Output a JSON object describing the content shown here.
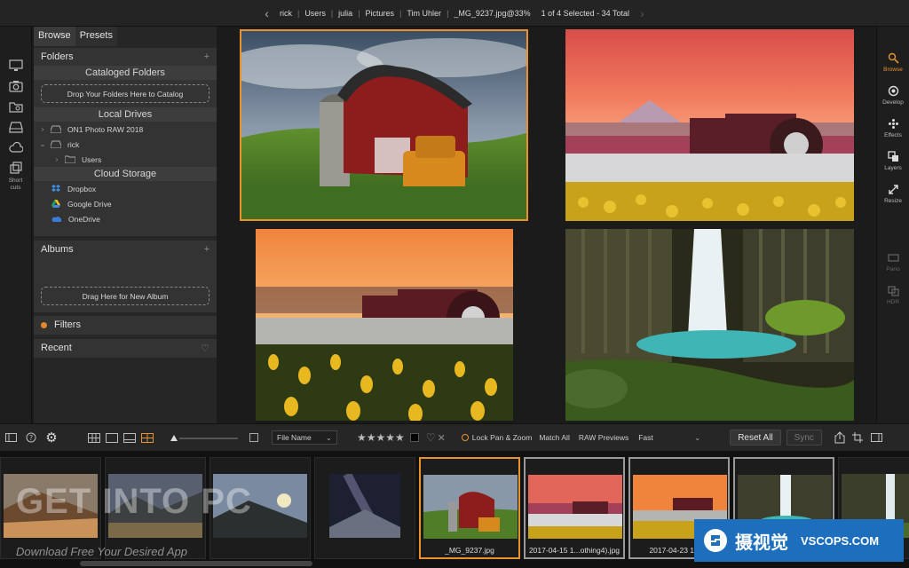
{
  "topbar": {
    "breadcrumbs": [
      "rick",
      "Users",
      "julia",
      "Pictures",
      "Tim Uhler",
      "_MG_9237.jpg@33%"
    ],
    "selection_status": "1 of 4 Selected - 34 Total"
  },
  "left_rail": {
    "shortcuts_label_1": "Short",
    "shortcuts_label_2": "cuts"
  },
  "panel": {
    "tabs": [
      "Browse",
      "Presets"
    ],
    "folders": {
      "title": "Folders",
      "cataloged_title": "Cataloged Folders",
      "drop_zone": "Drop Your Folders Here to Catalog",
      "local_drives_title": "Local Drives",
      "drives": [
        "ON1 Photo RAW 2018",
        "rick",
        "Users"
      ],
      "cloud_title": "Cloud Storage",
      "cloud": [
        "Dropbox",
        "Google Drive",
        "OneDrive"
      ]
    },
    "albums": {
      "title": "Albums",
      "drop_zone": "Drag Here for New Album"
    },
    "filters": {
      "title": "Filters"
    },
    "recent": {
      "title": "Recent"
    }
  },
  "right_rail": {
    "modules": [
      "Browse",
      "Develop",
      "Effects",
      "Layers",
      "Resize",
      "Pano",
      "HDR"
    ],
    "active_module": "Browse"
  },
  "toolbar": {
    "sort_field": "File Name",
    "lock_pan_zoom": "Lock Pan & Zoom",
    "match_all": "Match All",
    "raw_previews_label": "RAW Previews",
    "raw_previews_value": "Fast",
    "reset_all": "Reset All",
    "sync": "Sync"
  },
  "filmstrip": {
    "captions": [
      "",
      "",
      "",
      "",
      "_MG_9237.jpg",
      "2017-04-15 1...othing4).jpg",
      "2017-04-23 1...hlr",
      "",
      ""
    ]
  },
  "overlay": {
    "watermark": "GET INTO PC",
    "watermark_sub": "Download Free Your Desired App",
    "badge_cn": "摄视觉",
    "badge_en": "VSCOPS.COM"
  },
  "colors": {
    "accent": "#e8912d",
    "panel": "#333333",
    "background": "#1b1b1b"
  }
}
